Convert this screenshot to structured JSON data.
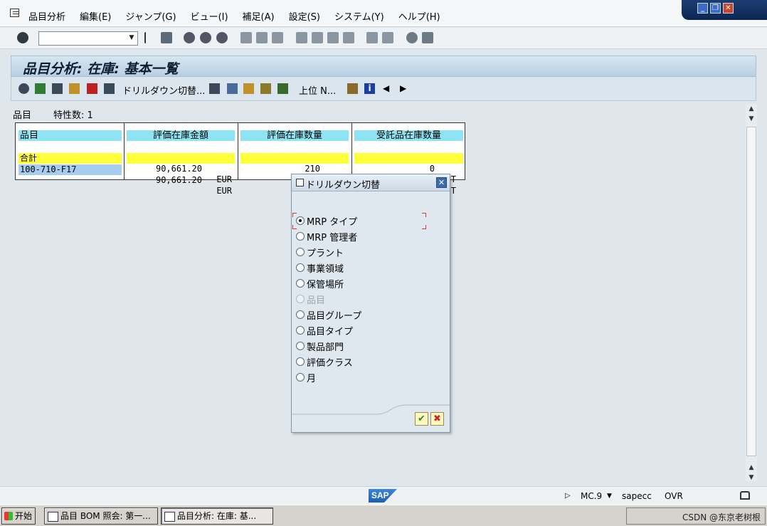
{
  "menu": {
    "items": [
      "品目分析",
      "編集(E)",
      "ジャンプ(G)",
      "ビュー(I)",
      "補足(A)",
      "設定(S)",
      "システム(Y)",
      "ヘルプ(H)"
    ]
  },
  "window_controls": {
    "minimize": "_",
    "restore": "❐",
    "close": "✕"
  },
  "command_field": {
    "value": ""
  },
  "page": {
    "title": "品目分析: 在庫: 基本一覧"
  },
  "app_toolbar": {
    "drilldown_label": "ドリルダウン切替...",
    "top_n_label": "上位 N..."
  },
  "info": {
    "label1": "品目",
    "label2": "特性数: 1"
  },
  "table": {
    "headers": [
      "品目",
      "評価在庫金額",
      "評価在庫数量",
      "受託品在庫数量"
    ],
    "rows": [
      {
        "material": "合計",
        "value": "90,661.20",
        "currency": "EUR",
        "qty": "210",
        "qty_unit": "ST",
        "consign": "0",
        "consign_unit": "ST"
      },
      {
        "material": "100-710-F17",
        "value": "90,661.20",
        "currency": "EUR",
        "qty": "210",
        "qty_unit": "ST",
        "consign": "0",
        "consign_unit": "ST"
      }
    ]
  },
  "popup": {
    "title": "ドリルダウン切替",
    "close": "✕",
    "options": [
      {
        "label": "MRP タイプ",
        "selected": true,
        "disabled": false
      },
      {
        "label": "MRP 管理者",
        "selected": false,
        "disabled": false
      },
      {
        "label": "プラント",
        "selected": false,
        "disabled": false
      },
      {
        "label": "事業領域",
        "selected": false,
        "disabled": false
      },
      {
        "label": "保管場所",
        "selected": false,
        "disabled": false
      },
      {
        "label": "品目",
        "selected": false,
        "disabled": true
      },
      {
        "label": "品目グループ",
        "selected": false,
        "disabled": false
      },
      {
        "label": "品目タイプ",
        "selected": false,
        "disabled": false
      },
      {
        "label": "製品部門",
        "selected": false,
        "disabled": false
      },
      {
        "label": "評価クラス",
        "selected": false,
        "disabled": false
      },
      {
        "label": "月",
        "selected": false,
        "disabled": false
      }
    ],
    "ok": "✔",
    "cancel": "✖"
  },
  "status": {
    "logo": "SAP",
    "tcode": "MC.9",
    "system": "sapecc",
    "mode": "OVR"
  },
  "taskbar": {
    "start": "开始",
    "tasks": [
      "品目 BOM 照会: 第一...",
      "品目分析: 在庫: 基..."
    ],
    "tray_text": "CSDN @东京老树根"
  },
  "colors": {
    "header_cyan": "#8fe4f4",
    "total_yellow": "#ffff3c",
    "selected_blue": "#a6cdf0",
    "title_bg": "#c9dbe9"
  }
}
